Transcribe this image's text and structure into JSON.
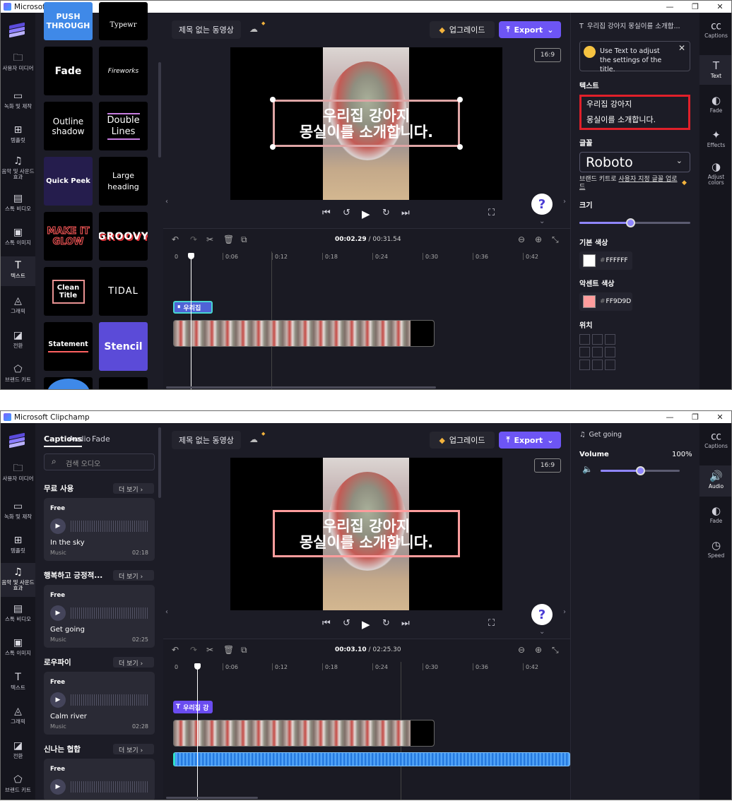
{
  "window": {
    "title": "Microsoft Clipchamp"
  },
  "nav": {
    "items": [
      "사용자 미디어",
      "녹화 및 제작",
      "템플릿",
      "음악 및 사운드 효과",
      "스톡 비디오",
      "스톡 이미지",
      "텍스트",
      "그래픽",
      "전환",
      "브랜드 키트"
    ]
  },
  "project": {
    "title": "제목 없는 동영상",
    "upgrade": "업그레이드",
    "export": "Export",
    "aspect": "16:9"
  },
  "caption": {
    "line1": "우리집 강아지",
    "line2": "몽실이를 소개합니다."
  },
  "ruler": {
    "ticks": [
      "0",
      "0:06",
      "0:12",
      "0:18",
      "0:24",
      "0:30",
      "0:36",
      "0:42"
    ]
  },
  "s1": {
    "tiles": [
      "PUSH THROUGH",
      "Typewr",
      "Fade",
      "Fireworks",
      "Outline shadow",
      "Double Lines",
      "Quick Peek",
      "Large heading",
      "MAKE IT GLOW",
      "GROOVY",
      "Clean Title",
      "TIDAL",
      "Statement",
      "Stencil"
    ],
    "time_current": "00:02.29",
    "time_total": "/ 00:31.54",
    "text_clip": "우리집",
    "right": {
      "title": "우리집 강아지 몽실이를 소개합...",
      "tip": "Use Text to adjust the settings of the title.",
      "text_label": "텍스트",
      "text_line1": "우리집 강아지",
      "text_line2": "몽실이를 소개합니다.",
      "font_label": "글꼴",
      "font": "Roboto",
      "brand_prefix": "브랜드 키트로 ",
      "brand_link": "사용자 지정 글꼴 업로드",
      "size_label": "크기",
      "base_color_label": "기본 색상",
      "base_color": "FFFFFF",
      "accent_label": "악센트 색상",
      "accent_color": "FF9D9D",
      "position_label": "위치",
      "size_value": 0.46
    },
    "tabs": [
      "Captions",
      "Text",
      "Fade",
      "Effects",
      "Adjust colors"
    ]
  },
  "s2": {
    "tabs": [
      "Captions",
      "Audio",
      "Fade",
      "Speed"
    ],
    "search_placeholder": "검색 오디오",
    "sections": [
      {
        "title": "무료 사용",
        "more": "더 보기",
        "track": {
          "badge": "Free",
          "name": "In the sky",
          "kind": "Music",
          "dur": "02:18"
        }
      },
      {
        "title": "행복하고 긍정적...",
        "more": "더 보기",
        "track": {
          "badge": "Free",
          "name": "Get going",
          "kind": "Music",
          "dur": "02:25"
        }
      },
      {
        "title": "로우파이",
        "more": "더 보기",
        "track": {
          "badge": "Free",
          "name": "Calm river",
          "kind": "Music",
          "dur": "02:28"
        }
      },
      {
        "title": "신나는 협합",
        "more": "더 보기",
        "track": {
          "badge": "Free",
          "name": "",
          "kind": "",
          "dur": ""
        }
      }
    ],
    "time_current": "00:03.10",
    "time_total": "/ 02:25.30",
    "text_clip": "우리집 강",
    "right": {
      "title": "Get going",
      "volume_label": "Volume",
      "volume_value": "100%",
      "volume": 1.0
    }
  }
}
